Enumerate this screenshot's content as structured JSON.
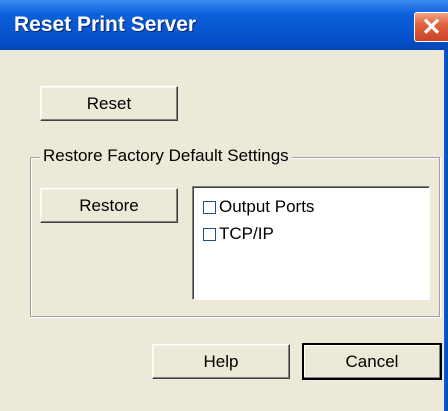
{
  "window": {
    "title": "Reset Print Server",
    "close_glyph": "✕"
  },
  "reset": {
    "button_label": "Reset"
  },
  "restore_group": {
    "label": "Restore Factory Default Settings",
    "button_label": "Restore",
    "options": [
      {
        "label": "Output Ports",
        "checked": false
      },
      {
        "label": "TCP/IP",
        "checked": false
      }
    ]
  },
  "footer": {
    "help_label": "Help",
    "cancel_label": "Cancel"
  },
  "colors": {
    "titlebar": "#0653d0",
    "face": "#ece9d8",
    "close": "#e0623f"
  }
}
